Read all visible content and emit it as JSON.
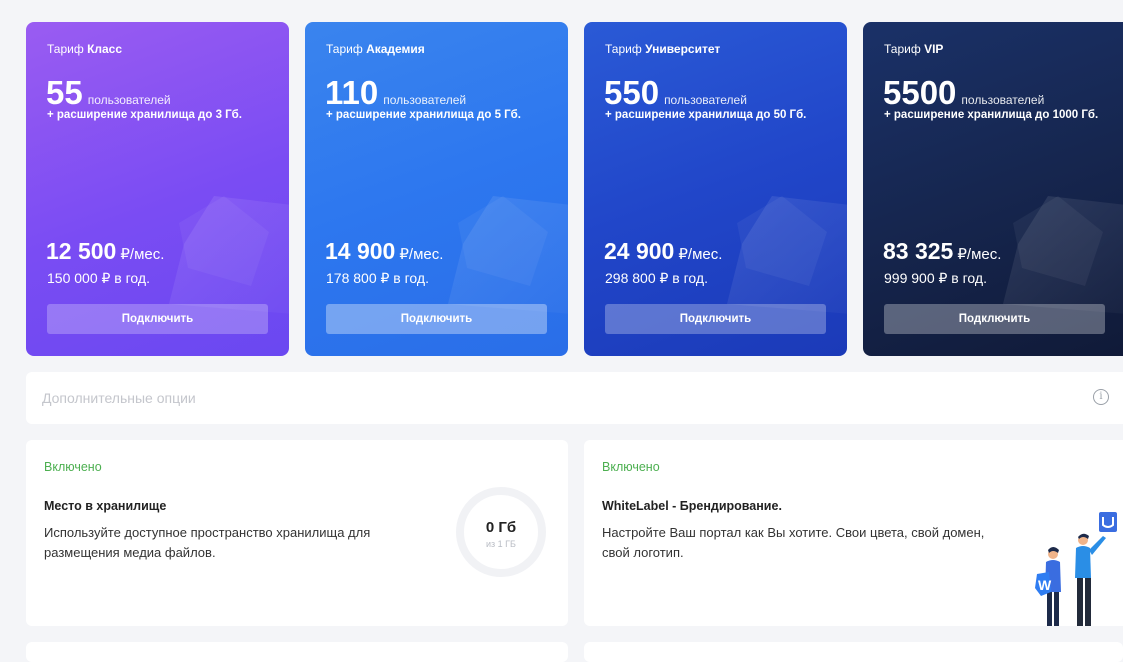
{
  "plans": [
    {
      "prefix": "Тариф",
      "name": "Класс",
      "users": "55",
      "users_unit": "пользователей",
      "storage": "+ расширение хранилища до 3 Гб.",
      "price": "12 500",
      "price_unit": "₽/мес.",
      "year": "150 000 ₽ в год.",
      "button": "Подключить"
    },
    {
      "prefix": "Тариф",
      "name": "Академия",
      "users": "110",
      "users_unit": "пользователей",
      "storage": "+ расширение хранилища до 5 Гб.",
      "price": "14 900",
      "price_unit": "₽/мес.",
      "year": "178 800 ₽ в год.",
      "button": "Подключить"
    },
    {
      "prefix": "Тариф",
      "name": "Университет",
      "users": "550",
      "users_unit": "пользователей",
      "storage": "+ расширение хранилища до 50 Гб.",
      "price": "24 900",
      "price_unit": "₽/мес.",
      "year": "298 800 ₽ в год.",
      "button": "Подключить"
    },
    {
      "prefix": "Тариф",
      "name": "VIP",
      "users": "5500",
      "users_unit": "пользователей",
      "storage": "+ расширение хранилища до 1000 Гб.",
      "price": "83 325",
      "price_unit": "₽/мес.",
      "year": "999 900 ₽ в год.",
      "button": "Подключить"
    }
  ],
  "options": {
    "label": "Дополнительные опции",
    "info_icon": "info-icon"
  },
  "features": [
    {
      "status": "Включено",
      "title": "Место в хранилище",
      "description": "Используйте доступное пространство хранилища для размещения медиа файлов.",
      "usage_value": "0 Гб",
      "usage_total": "из 1 ГБ"
    },
    {
      "status": "Включено",
      "title": "WhiteLabel - Брендирование.",
      "description": "Настройте Ваш портал как Вы хотите. Свои цвета, свой домен, свой логотип.",
      "illustration": "people-branding-illustration"
    }
  ],
  "colors": {
    "status_green": "#4caf50",
    "plan1": "#7a4cf3",
    "plan2": "#2d77ef",
    "plan3": "#2146c9",
    "plan4": "#16264f"
  }
}
